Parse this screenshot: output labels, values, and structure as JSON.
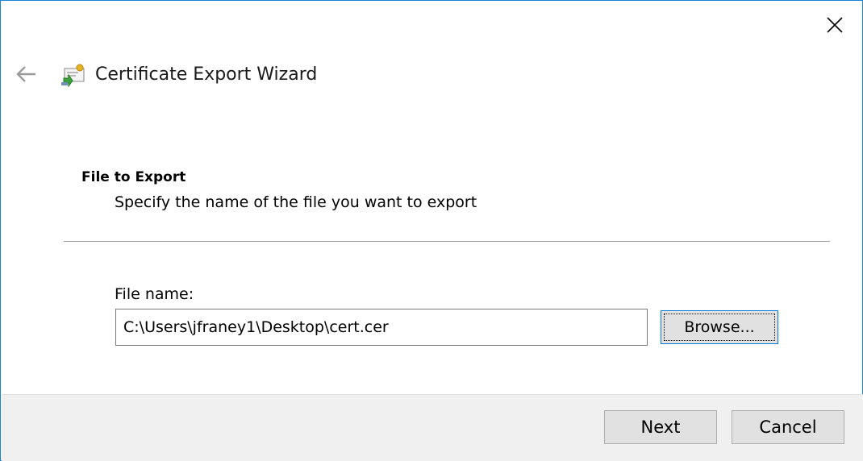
{
  "window": {
    "title": "Certificate Export Wizard",
    "accent_color": "#1883d7"
  },
  "icons": {
    "close": "close-icon",
    "back": "back-arrow-icon",
    "wizard": "certificate-icon"
  },
  "page": {
    "section_title": "File to Export",
    "section_subtitle": "Specify the name of the file you want to export"
  },
  "file_field": {
    "label": "File name:",
    "value": "C:\\Users\\jfraney1\\Desktop\\cert.cer",
    "browse_label": "Browse..."
  },
  "footer": {
    "next_label": "Next",
    "cancel_label": "Cancel"
  }
}
